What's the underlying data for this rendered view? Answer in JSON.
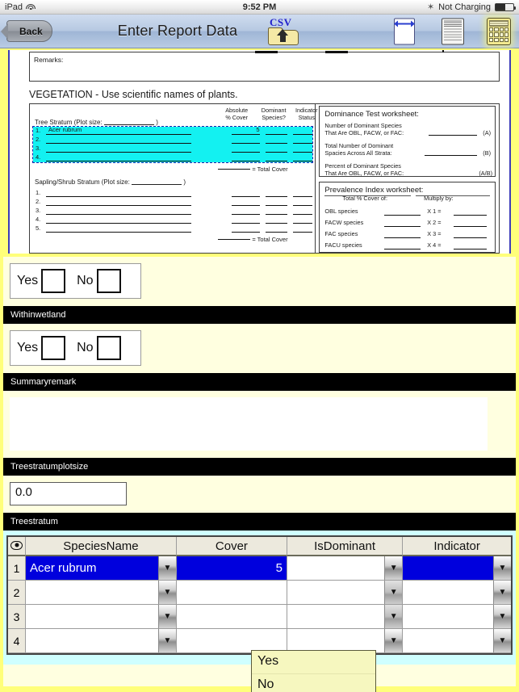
{
  "status_bar": {
    "device": "iPad",
    "wifi_icon": "wifi-icon",
    "time": "9:52 PM",
    "bluetooth_icon": "bluetooth-icon",
    "battery_text": "Not Charging",
    "battery_icon": "battery-icon"
  },
  "nav": {
    "back_label": "Back",
    "title": "Enter Report Data",
    "icons": [
      {
        "name": "csv-export-icon",
        "label": "CSV"
      },
      {
        "name": "page-width-icon",
        "label": ""
      },
      {
        "name": "refresh-report-icon",
        "label": ""
      },
      {
        "name": "calculator-icon",
        "label": ""
      }
    ]
  },
  "form_image": {
    "remarks_label": "Remarks:",
    "vegetation_title": "VEGETATION - Use scientific names of plants.",
    "column_headers": [
      "Absolute\n% Cover",
      "Dominant\nSpecies?",
      "Indicator\nStatus"
    ],
    "col_absolute_l1": "Absolute",
    "col_absolute_l2": "% Cover",
    "col_dominant_l1": "Dominant",
    "col_dominant_l2": "Species?",
    "col_indicator_l1": "Indicator",
    "col_indicator_l2": "Status",
    "tree_stratum_label": "Tree Stratum   (Plot size:",
    "tree_stratum_close": ")",
    "tree_rows": [
      {
        "num": "1.",
        "name": "Acer rubrum",
        "cover": "5"
      },
      {
        "num": "2.",
        "name": "",
        "cover": ""
      },
      {
        "num": "3.",
        "name": "",
        "cover": ""
      },
      {
        "num": "4.",
        "name": "",
        "cover": ""
      }
    ],
    "total_cover_label": "= Total Cover",
    "sapling_label": "Sapling/Shrub Stratum  (Plot size:",
    "sapling_close": ")",
    "sapling_rows": [
      "1.",
      "2.",
      "3.",
      "4.",
      "5."
    ],
    "dominance": {
      "title": "Dominance Test worksheet:",
      "rows": [
        {
          "l1": "Number of Dominant Species",
          "l2": "That Are OBL, FACW, or FAC:",
          "tag": "(A)"
        },
        {
          "l1": "Total Number of Dominant",
          "l2": "Spacies Across All Strata:",
          "tag": "(B)"
        },
        {
          "l1": "Percent of Dominant Species",
          "l2": "That Are OBL, FACW, or FAC:",
          "tag": "(A/B)"
        }
      ]
    },
    "prevalence": {
      "title": "Prevalence Index worksheet:",
      "head_left": "Total  %  Cover  of:",
      "head_right": "Multiply by:",
      "rows": [
        {
          "label": "OBL species",
          "mult": "X 1 ="
        },
        {
          "label": "FACW species",
          "mult": "X 2 ="
        },
        {
          "label": "FAC species",
          "mult": "X 3 ="
        },
        {
          "label": "FACU species",
          "mult": "X 4 ="
        }
      ]
    }
  },
  "sections": {
    "hydrophytic": {
      "yes_label": "Yes",
      "no_label": "No"
    },
    "withinwetland": {
      "header": "Withinwetland",
      "yes_label": "Yes",
      "no_label": "No"
    },
    "summaryremark": {
      "header": "Summaryremark",
      "value": ""
    },
    "treestratumplotsize": {
      "header": "Treestratumplotsize",
      "value": "0.0"
    },
    "treestratum": {
      "header": "Treestratum"
    }
  },
  "grid": {
    "row_header_icon": "eye-icon",
    "columns": [
      "SpeciesName",
      "Cover",
      "IsDominant",
      "Indicator"
    ],
    "rows": [
      {
        "num": "1",
        "species": "Acer rubrum",
        "cover": "5",
        "isdominant": "",
        "indicator": "",
        "selected": true
      },
      {
        "num": "2",
        "species": "",
        "cover": "",
        "isdominant": "",
        "indicator": "",
        "selected": false
      },
      {
        "num": "3",
        "species": "",
        "cover": "",
        "isdominant": "",
        "indicator": "",
        "selected": false
      },
      {
        "num": "4",
        "species": "",
        "cover": "",
        "isdominant": "",
        "indicator": "",
        "selected": false
      }
    ],
    "dropdown_open": {
      "column": "IsDominant",
      "options": [
        "Yes",
        "No"
      ]
    },
    "dropdown_glyph": "▼"
  },
  "colors": {
    "selection_blue": "#0000dd",
    "highlight_cyan": "#13f1f1",
    "panel_yellow": "#ffff7a",
    "page_cream": "#ffffe0",
    "grid_backdrop": "#cfffff",
    "dropdown_yellow": "#f6f7bf"
  }
}
